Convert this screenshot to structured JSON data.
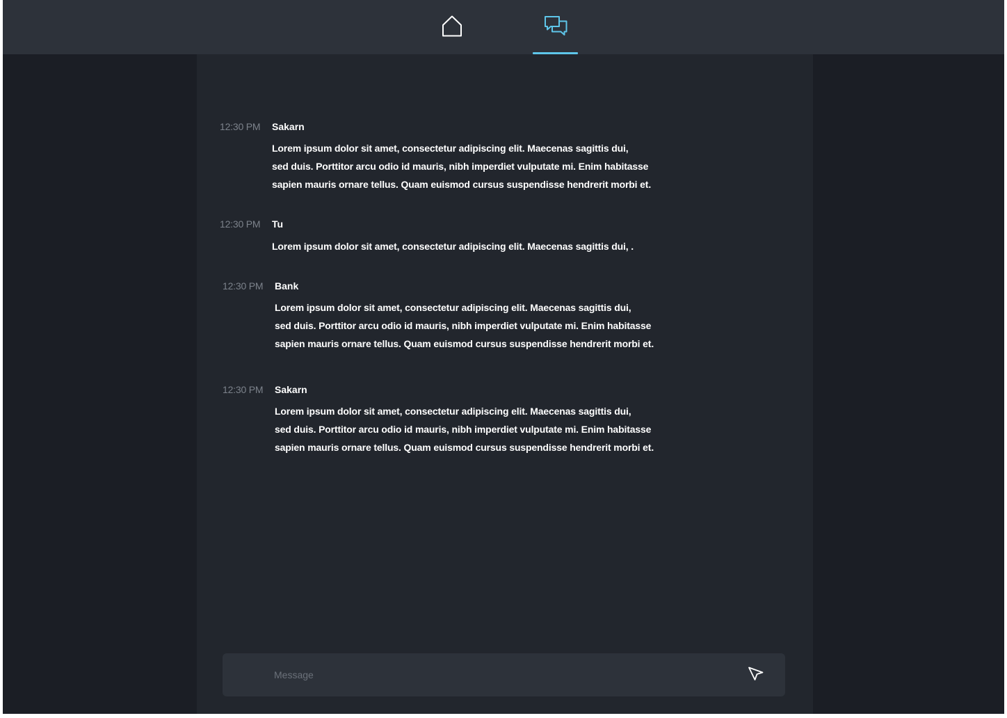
{
  "nav": {
    "items": [
      {
        "icon": "home-icon",
        "active": false
      },
      {
        "icon": "chat-icon",
        "active": true
      }
    ],
    "accent_color": "#5ec6ea"
  },
  "messages": [
    {
      "time": "12:30 PM",
      "sender": "Sakarn",
      "lines": [
        "Lorem ipsum dolor sit amet,  consectetur adipiscing elit. Maecenas sagittis dui,",
        "sed duis. Porttitor arcu odio id mauris, nibh imperdiet vulputate mi. Enim habitasse",
        "sapien mauris ornare tellus. Quam euismod cursus suspendisse hendrerit morbi et."
      ]
    },
    {
      "time": "12:30 PM",
      "sender": "Tu",
      "lines": [
        "Lorem ipsum dolor sit amet,  consectetur adipiscing elit. Maecenas sagittis dui, ."
      ]
    },
    {
      "time": "12:30 PM",
      "sender": "Bank",
      "lines": [
        "Lorem ipsum dolor sit amet,  consectetur adipiscing elit. Maecenas sagittis dui,",
        "sed duis. Porttitor arcu odio id mauris, nibh imperdiet vulputate mi. Enim habitasse",
        "sapien mauris ornare tellus. Quam euismod cursus suspendisse hendrerit morbi et."
      ]
    },
    {
      "time": "12:30 PM",
      "sender": "Sakarn",
      "lines": [
        "Lorem ipsum dolor sit amet,  consectetur adipiscing elit. Maecenas sagittis dui,",
        "sed duis. Porttitor arcu odio id mauris, nibh imperdiet vulputate mi. Enim habitasse",
        "sapien mauris ornare tellus. Quam euismod cursus suspendisse hendrerit morbi et."
      ]
    }
  ],
  "composer": {
    "placeholder": "Message",
    "value": "",
    "send_icon": "send-icon"
  }
}
